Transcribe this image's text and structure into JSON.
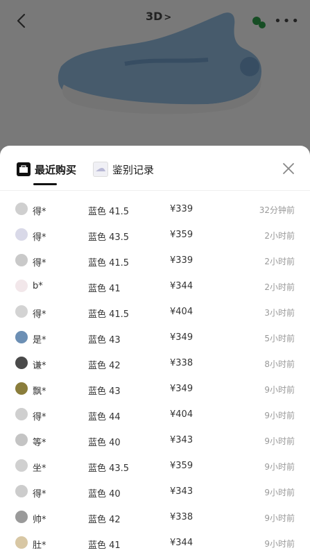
{
  "header": {
    "view_3d_label": "3D",
    "view_3d_chevron": ">",
    "more_label": "•••"
  },
  "sheet": {
    "tabs": [
      {
        "label": "最近购买",
        "icon": "purchase-icon",
        "active": true
      },
      {
        "label": "鉴别记录",
        "icon": "appraisal-icon",
        "active": false
      }
    ],
    "close_icon": "close-icon",
    "records": [
      {
        "user": "得*",
        "spec": "蓝色 41.5",
        "price": "¥339",
        "time": "32分钟前"
      },
      {
        "user": "得*",
        "spec": "蓝色 43.5",
        "price": "¥359",
        "time": "2小时前"
      },
      {
        "user": "得*",
        "spec": "蓝色 41.5",
        "price": "¥339",
        "time": "2小时前"
      },
      {
        "user": "b*",
        "spec": "蓝色 41",
        "price": "¥344",
        "time": "2小时前"
      },
      {
        "user": "得*",
        "spec": "蓝色 41.5",
        "price": "¥404",
        "time": "3小时前"
      },
      {
        "user": "是*",
        "spec": "蓝色 43",
        "price": "¥349",
        "time": "5小时前"
      },
      {
        "user": "谦*",
        "spec": "蓝色 42",
        "price": "¥338",
        "time": "8小时前"
      },
      {
        "user": "飘*",
        "spec": "蓝色 43",
        "price": "¥349",
        "time": "9小时前"
      },
      {
        "user": "得*",
        "spec": "蓝色 44",
        "price": "¥404",
        "time": "9小时前"
      },
      {
        "user": "等*",
        "spec": "蓝色 40",
        "price": "¥343",
        "time": "9小时前"
      },
      {
        "user": "坐*",
        "spec": "蓝色 43.5",
        "price": "¥359",
        "time": "9小时前"
      },
      {
        "user": "得*",
        "spec": "蓝色 40",
        "price": "¥343",
        "time": "9小时前"
      },
      {
        "user": "帅*",
        "spec": "蓝色 42",
        "price": "¥338",
        "time": "9小时前"
      },
      {
        "user": "肚*",
        "spec": "蓝色 41",
        "price": "¥344",
        "time": "9小时前"
      }
    ]
  },
  "colors": {
    "sheet_background": "#ffffff",
    "text_primary": "#333333",
    "text_muted": "#999999",
    "shoe_blue": "#8fb7d9"
  }
}
